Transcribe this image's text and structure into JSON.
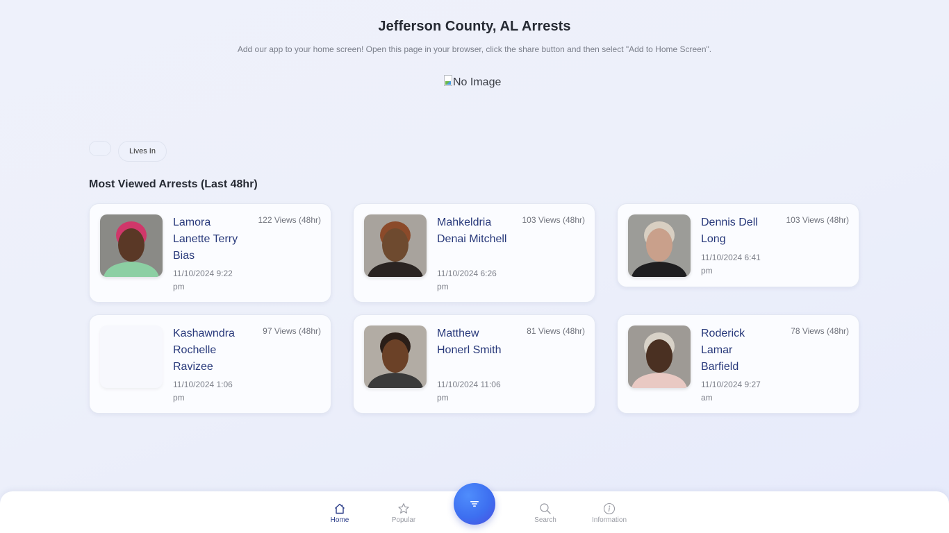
{
  "header": {
    "title": "Jefferson County, AL Arrests",
    "subtitle": "Add our app to your home screen! Open this page in your browser, click the share button and then select \"Add to Home Screen\".",
    "image_alt": "No Image"
  },
  "filters": {
    "chips": [
      "",
      "Lives In"
    ]
  },
  "section": {
    "title": "Most Viewed Arrests (Last 48hr)"
  },
  "arrests": [
    {
      "name": "Lamora Lanette Terry Bias",
      "date": "11/10/2024 9:22 pm",
      "views": "122 Views (48hr)",
      "has_photo": true,
      "photo_colors": [
        "#8a8a86",
        "#5a3826",
        "#d0376a",
        "#8ccfa3"
      ]
    },
    {
      "name": "Mahkeldria Denai Mitchell",
      "date": "11/10/2024 6:26 pm",
      "views": "103 Views (48hr)",
      "has_photo": true,
      "photo_colors": [
        "#a8a39d",
        "#6e4a2f",
        "#8b4a2a",
        "#2a2422"
      ]
    },
    {
      "name": "Dennis Dell Long",
      "date": "11/10/2024 6:41 pm",
      "views": "103 Views (48hr)",
      "has_photo": true,
      "photo_colors": [
        "#9c9c98",
        "#c9a08b",
        "#d8cfc2",
        "#1e1e20"
      ]
    },
    {
      "name": "Kashawndra Rochelle Ravizee",
      "date": "11/10/2024 1:06 pm",
      "views": "97 Views (48hr)",
      "has_photo": false,
      "photo_colors": []
    },
    {
      "name": "Matthew Honerl Smith",
      "date": "11/10/2024 11:06 pm",
      "views": "81 Views (48hr)",
      "has_photo": true,
      "photo_colors": [
        "#b2aca4",
        "#6b4127",
        "#2a1e18",
        "#3a3a3a"
      ]
    },
    {
      "name": "Roderick Lamar Barfield",
      "date": "11/10/2024 9:27 am",
      "views": "78 Views (48hr)",
      "has_photo": true,
      "photo_colors": [
        "#9e9a95",
        "#4a3022",
        "#d8d2c8",
        "#e9c9c3"
      ]
    }
  ],
  "nav": {
    "items": [
      {
        "label": "Home",
        "icon": "home-icon",
        "active": true
      },
      {
        "label": "Popular",
        "icon": "star-icon",
        "active": false
      },
      {
        "label": "Search",
        "icon": "search-icon",
        "active": false
      },
      {
        "label": "Information",
        "icon": "info-icon",
        "active": false
      }
    ],
    "fab_icon": "filter-icon",
    "accent_color": "#3d6ff0"
  }
}
